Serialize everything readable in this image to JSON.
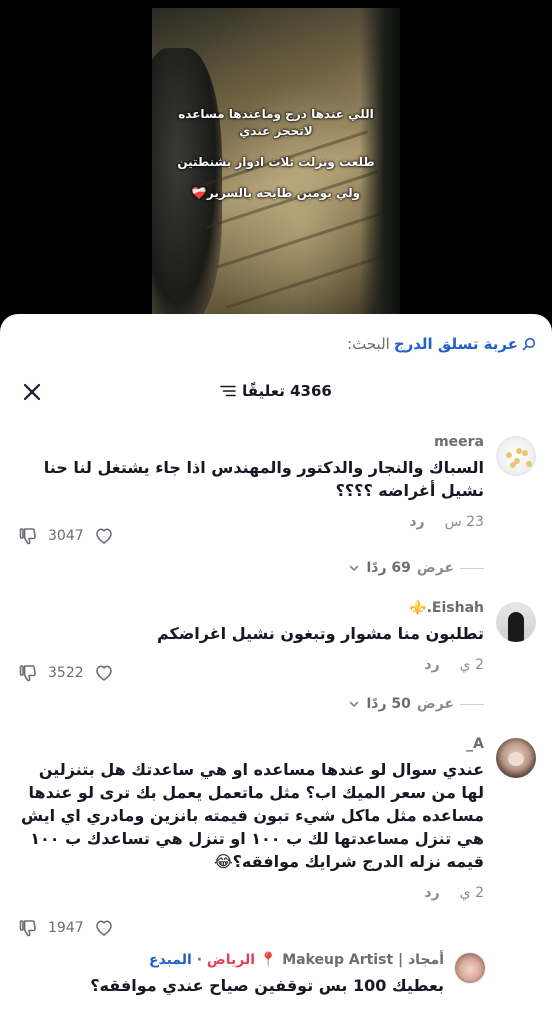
{
  "video": {
    "caption_line_1": "اللي عندها درج وماعندها مساعده",
    "caption_line_2": "لاتحجز عندي",
    "caption_line_3": "طلعت ونزلت ثلاث ادوار بشنطتين",
    "caption_line_4": "ولي يومين طايحه بالسرير❤️‍🩹"
  },
  "search": {
    "prefix": "البحث:",
    "query": "عربة تسلق الدرج",
    "icon": "search-icon"
  },
  "header": {
    "comment_count": "4366 تعليقًا",
    "filter_icon": "filter-icon",
    "close_icon": "close-icon"
  },
  "comments": [
    {
      "author": "meera",
      "text": "السباك والنجار والدكتور والمهندس اذا جاء يشتغل لنا حنا نشيل أغراضه ؟؟؟؟",
      "time": "23 س",
      "reply_label": "رد",
      "likes": "3047",
      "view_replies_label": "عرض",
      "view_replies_count": "69 ردًا"
    },
    {
      "author": "Eishah.⚜️",
      "text": "تطلبون منا مشوار وتبغون نشيل اغراضكم",
      "time": "2 ي",
      "reply_label": "رد",
      "likes": "3522",
      "view_replies_label": "عرض",
      "view_replies_count": "50 ردًا"
    },
    {
      "author": "A_",
      "text": "عندي سوال لو عندها مساعده او هي ساعدتك هل بتنزلين لها من سعر الميك اب؟ مثل ماتعمل يعمل بك ترى لو عندها مساعده مثل ماكل شيء تبون قيمته بانزين ومادري اي ايش هي تنزل مساعدتها لك ب ١٠٠ او تنزل هي تساعدك ب ١٠٠ قيمه نزله الدرج شرايك موافقه؟😂",
      "time": "2 ي",
      "reply_label": "رد",
      "likes": "1947"
    }
  ],
  "sub_comment": {
    "author": "أمجاد | Makeup Artist",
    "location": "📍 الرياض",
    "separator": "·",
    "badge": "المبدع",
    "text": "بعطيك 100 بس توقفين صياح عندي موافقه؟"
  }
}
